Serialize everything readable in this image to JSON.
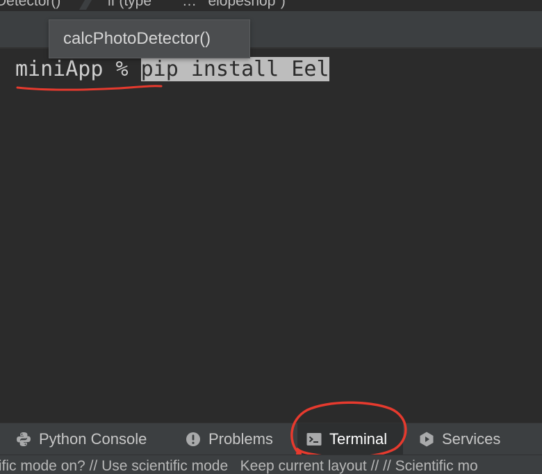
{
  "breadcrumb": {
    "items": [
      "Detector()",
      "if (type",
      "…",
      "\"elopeshop\")"
    ]
  },
  "tooltip": {
    "text": "calcPhotoDetector()"
  },
  "terminal": {
    "prompt": "miniApp % ",
    "command": "pip install Eel"
  },
  "tool_windows": {
    "tabs": [
      {
        "label": "Python Console",
        "icon": "python-icon",
        "active": false
      },
      {
        "label": "Problems",
        "icon": "problems-icon",
        "active": false
      },
      {
        "label": "Terminal",
        "icon": "terminal-icon",
        "active": true
      },
      {
        "label": "Services",
        "icon": "services-icon",
        "active": false
      }
    ]
  },
  "status_bar": {
    "text": "tific mode on? // Use scientific mode   Keep current layout // // Scientific mo"
  },
  "colors": {
    "background": "#2b2b2b",
    "panel": "#3c3f41",
    "annotation_red": "#e63a2e",
    "selection": "#bdbdbd"
  }
}
